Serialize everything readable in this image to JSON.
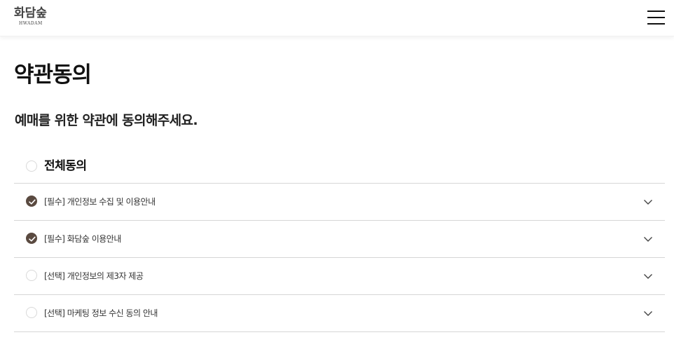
{
  "header": {
    "logo_main": "화담숲",
    "logo_sub": "HWADAM",
    "menu_icon": "hamburger-menu-icon"
  },
  "page": {
    "title": "약관동의",
    "subtitle": "예매를 위한 약관에 동의해주세요."
  },
  "agree_all": {
    "label": "전체동의",
    "checked": false
  },
  "terms": [
    {
      "label": "[필수] 개인정보 수집 및 이용안내",
      "checked": true
    },
    {
      "label": "[필수] 화담숲 이용안내",
      "checked": true
    },
    {
      "label": "[선택] 개인정보의 제3자 제공",
      "checked": false
    },
    {
      "label": "[선택] 마케팅 정보 수신 동의 안내",
      "checked": false
    }
  ],
  "colors": {
    "check_fill": "#5a4a40",
    "divider": "#d6d6d6",
    "unchecked_border": "#d9d9d9"
  }
}
